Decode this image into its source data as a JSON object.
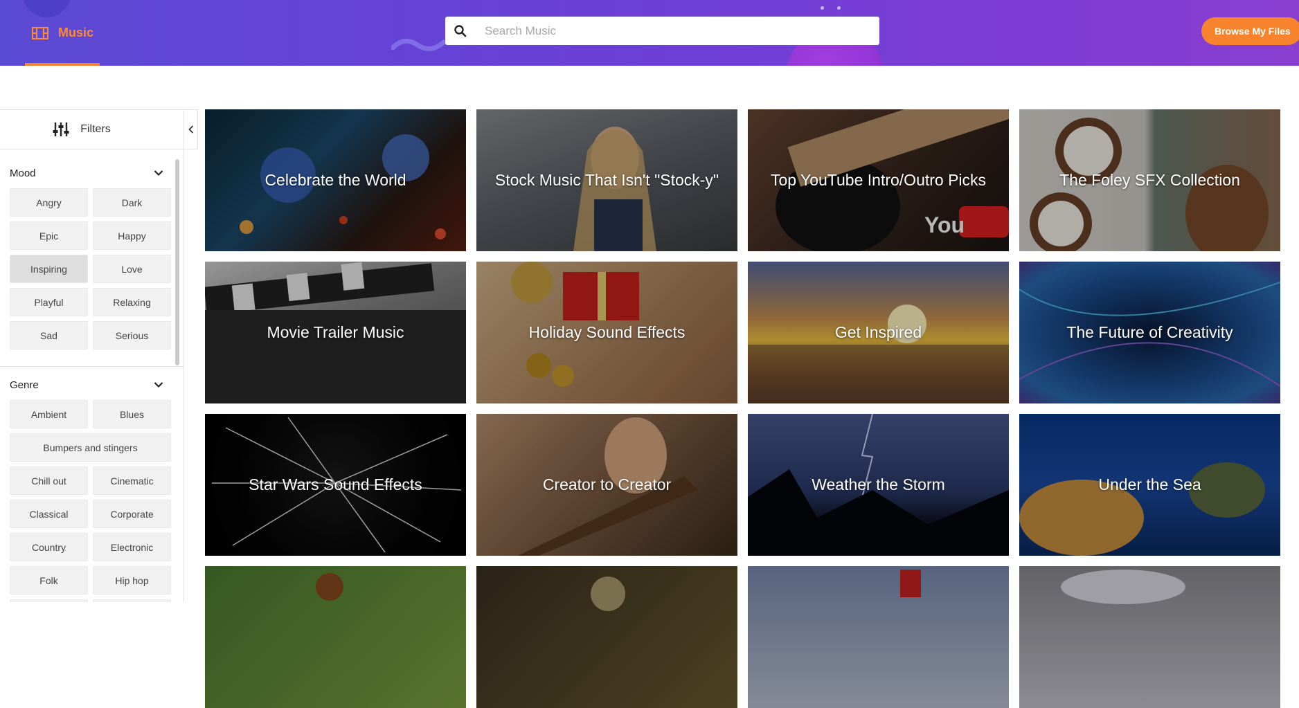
{
  "header": {
    "brand_label": "Music",
    "search_placeholder": "Search Music",
    "search_value": "",
    "browse_label": "Browse My Files",
    "colors": {
      "accent": "#f7842c",
      "header_start": "#5b4ad4",
      "header_end": "#8a3ed0"
    }
  },
  "sidebar": {
    "filters_label": "Filters",
    "mood": {
      "title": "Mood",
      "options": [
        "Angry",
        "Dark",
        "Epic",
        "Happy",
        "Inspiring",
        "Love",
        "Playful",
        "Relaxing",
        "Sad",
        "Serious"
      ],
      "selected": "Inspiring"
    },
    "genre": {
      "title": "Genre",
      "options": [
        "Ambient",
        "Blues",
        "Bumpers and stingers",
        "Chill out",
        "Cinematic",
        "Classical",
        "Corporate",
        "Country",
        "Electronic",
        "Folk",
        "Hip hop"
      ]
    }
  },
  "collections": [
    {
      "title": "Celebrate the World",
      "icon": "bells-image"
    },
    {
      "title": "Stock Music That Isn't \"Stock-y\"",
      "icon": "woman-headphones-image"
    },
    {
      "title": "Top YouTube Intro/Outro Picks",
      "icon": "guitar-youtube-image"
    },
    {
      "title": "The Foley SFX Collection",
      "icon": "coconut-horse-image"
    },
    {
      "title": "Movie Trailer Music",
      "icon": "clapperboard-image"
    },
    {
      "title": "Holiday Sound Effects",
      "icon": "gifts-bells-image"
    },
    {
      "title": "Get Inspired",
      "icon": "sunset-sea-image"
    },
    {
      "title": "The Future of Creativity",
      "icon": "abstract-blue-image"
    },
    {
      "title": "Star Wars Sound Effects",
      "icon": "hyperspace-image"
    },
    {
      "title": "Creator to Creator",
      "icon": "girl-guitar-image"
    },
    {
      "title": "Weather the Storm",
      "icon": "lightning-storm-image"
    },
    {
      "title": "Under the Sea",
      "icon": "sea-turtle-image"
    },
    {
      "title": "",
      "icon": "nature-image"
    },
    {
      "title": "",
      "icon": "sparkler-image"
    },
    {
      "title": "",
      "icon": "sky-flag-image"
    },
    {
      "title": "",
      "icon": "cloudy-sky-image"
    }
  ]
}
